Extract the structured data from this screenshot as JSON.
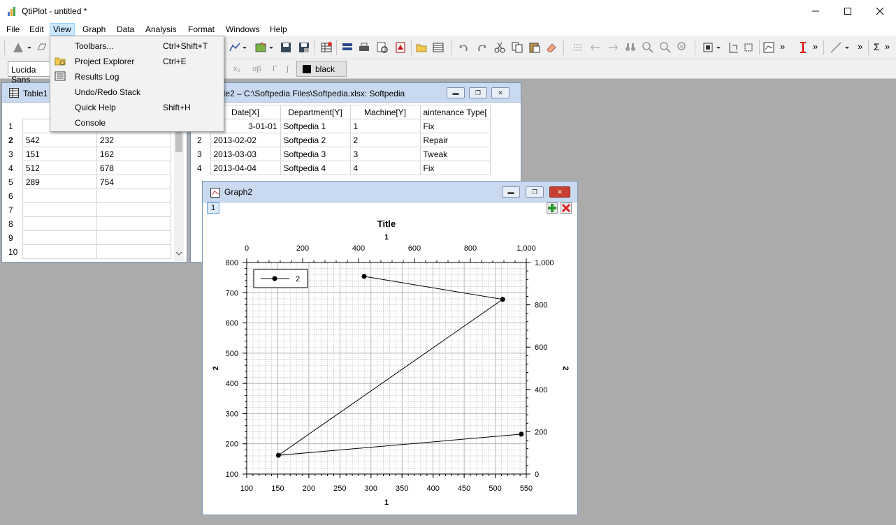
{
  "window": {
    "title": "QtiPlot - untitled *"
  },
  "menubar": [
    "File",
    "Edit",
    "View",
    "Graph",
    "Data",
    "Analysis",
    "Format",
    "Windows",
    "Help"
  ],
  "view_menu": [
    {
      "label": "Toolbars...",
      "shortcut": "Ctrl+Shift+T"
    },
    {
      "label": "Project Explorer",
      "shortcut": "Ctrl+E"
    },
    {
      "label": "Results Log",
      "shortcut": ""
    },
    {
      "label": "Undo/Redo Stack",
      "shortcut": ""
    },
    {
      "label": "Quick Help",
      "shortcut": "Shift+H"
    },
    {
      "label": "Console",
      "shortcut": ""
    }
  ],
  "format_toolbar": {
    "font": "Lucida Sans",
    "subscript": "x₂",
    "greek": "αβ",
    "gamma": "Γ",
    "integral": "∫",
    "color_label": "black"
  },
  "table1": {
    "title": "Table1",
    "rows": [
      {
        "n": "1",
        "a": "",
        "b": ""
      },
      {
        "n": "2",
        "a": "542",
        "b": "232"
      },
      {
        "n": "3",
        "a": "151",
        "b": "162"
      },
      {
        "n": "4",
        "a": "512",
        "b": "678"
      },
      {
        "n": "5",
        "a": "289",
        "b": "754"
      },
      {
        "n": "6",
        "a": "",
        "b": ""
      },
      {
        "n": "7",
        "a": "",
        "b": ""
      },
      {
        "n": "8",
        "a": "",
        "b": ""
      },
      {
        "n": "9",
        "a": "",
        "b": ""
      },
      {
        "n": "10",
        "a": "",
        "b": ""
      }
    ]
  },
  "table2": {
    "title": "ble2 – C:\\Softpedia Files\\Softpedia.xlsx: Softpedia",
    "headers": [
      "Date[X]",
      "Department[Y]",
      "Machine[Y]",
      "aintenance Type["
    ],
    "rows": [
      {
        "n": "",
        "date": "3-01-01",
        "dept": "Softpedia 1",
        "machine": "1",
        "type": "Fix"
      },
      {
        "n": "2",
        "date": "2013-02-02",
        "dept": "Softpedia 2",
        "machine": "2",
        "type": "Repair"
      },
      {
        "n": "3",
        "date": "2013-03-03",
        "dept": "Softpedia 3",
        "machine": "3",
        "type": "Tweak"
      },
      {
        "n": "4",
        "date": "2013-04-04",
        "dept": "Softpedia 4",
        "machine": "4",
        "type": "Fix"
      }
    ]
  },
  "graph": {
    "title": "Graph2",
    "layer": "1"
  },
  "chart_data": {
    "type": "line",
    "title": "Title",
    "xlabel": "1",
    "ylabel": "2",
    "x2label": "1",
    "y2label": "2",
    "xlim": [
      100,
      550
    ],
    "ylim": [
      100,
      800
    ],
    "x2lim": [
      0,
      1000
    ],
    "y2lim": [
      0,
      1000
    ],
    "xticks": [
      "100",
      "150",
      "200",
      "250",
      "300",
      "350",
      "400",
      "450",
      "500",
      "550"
    ],
    "yticks": [
      "100",
      "200",
      "300",
      "400",
      "500",
      "600",
      "700",
      "800"
    ],
    "x2ticks": [
      "0",
      "200",
      "400",
      "600",
      "800",
      "1,000"
    ],
    "y2ticks": [
      "0",
      "200",
      "400",
      "600",
      "800",
      "1,000"
    ],
    "grid": true,
    "legend": "top-left",
    "series": [
      {
        "name": "2",
        "x": [
          542,
          151,
          512,
          289
        ],
        "y": [
          232,
          162,
          678,
          754
        ]
      }
    ]
  }
}
